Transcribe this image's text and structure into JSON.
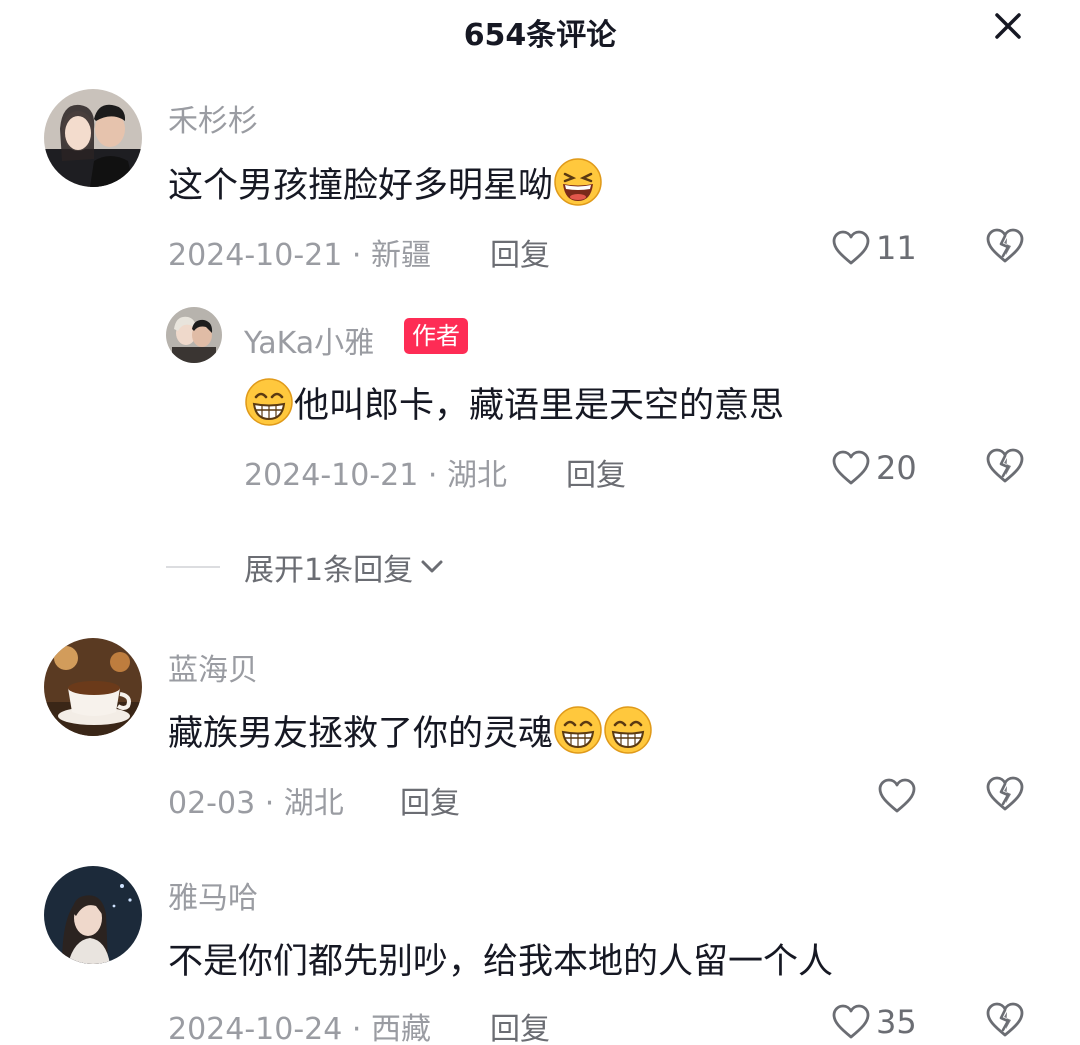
{
  "header": {
    "title": "654条评论"
  },
  "comments": [
    {
      "username": "禾杉杉",
      "text": "这个男孩撞脸好多明星呦",
      "emoji": "laughing-emoji",
      "meta": "2024-10-21 · 新疆",
      "reply_label": "回复",
      "likes": "11"
    },
    {
      "username": "YaKa小雅",
      "badge": "作者",
      "text": "他叫郎卡，藏语里是天空的意思",
      "emoji": "grinning-emoji",
      "meta": "2024-10-21 · 湖北",
      "reply_label": "回复",
      "likes": "20"
    },
    {
      "username": "蓝海贝",
      "text": "藏族男友拯救了你的灵魂",
      "emoji": "grinning-emoji",
      "meta": "02-03 · 湖北",
      "reply_label": "回复",
      "likes": ""
    },
    {
      "username": "雅马哈",
      "text": "不是你们都先别吵，给我本地的人留一个人",
      "meta": "2024-10-24 · 西藏",
      "reply_label": "回复",
      "likes": "35"
    }
  ],
  "expand_replies": {
    "label": "展开1条回复"
  },
  "icons": {
    "close": "close-icon",
    "like": "heart-icon",
    "dislike": "broken-heart-icon",
    "expand": "chevron-down-icon"
  },
  "colors": {
    "text": "#161823",
    "secondary": "#9a9ca2",
    "badge": "#fe2c55",
    "emoji_face": "#ffc83d"
  }
}
